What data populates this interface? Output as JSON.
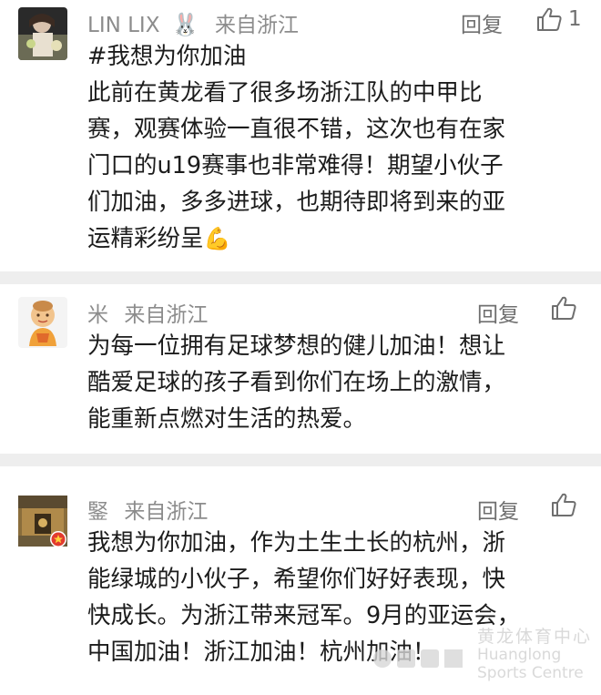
{
  "comments": [
    {
      "user": "LIN LIX",
      "user_emoji": "🐰",
      "location": "来自浙江",
      "reply_label": "回复",
      "like_count": "1",
      "lines": [
        "#我想为你加油",
        "此前在黄龙看了很多场浙江队的中甲比",
        "赛，观赛体验一直很不错，这次也有在家",
        "门口的u19赛事也非常难得！期望小伙子",
        "们加油，多多进球，也期待即将到来的亚",
        "运精彩纷呈"
      ],
      "trailing_emoji": "💪"
    },
    {
      "user": "米",
      "location": "来自浙江",
      "reply_label": "回复",
      "like_count": "",
      "lines": [
        "为每一位拥有足球梦想的健儿加油！想让",
        "酷爱足球的孩子看到你们在场上的激情，",
        "能重新点燃对生活的热爱。"
      ]
    },
    {
      "user": "鋻",
      "location": "来自浙江",
      "reply_label": "回复",
      "like_count": "",
      "lines": [
        "我想为你加油，作为土生土长的杭州，浙",
        "能绿城的小伙子，希望你们好好表现，快",
        "快成长。为浙江带来冠军。9月的亚运会，",
        "中国加油！浙江加油！杭州加油！"
      ]
    }
  ],
  "watermark": {
    "cn": "黄龙体育中心",
    "en1": "Huanglong",
    "en2": "Sports Centre"
  },
  "colors": {
    "meta": "#8c8c8c",
    "text": "#1c1c1c",
    "separator": "#eeeeee"
  }
}
